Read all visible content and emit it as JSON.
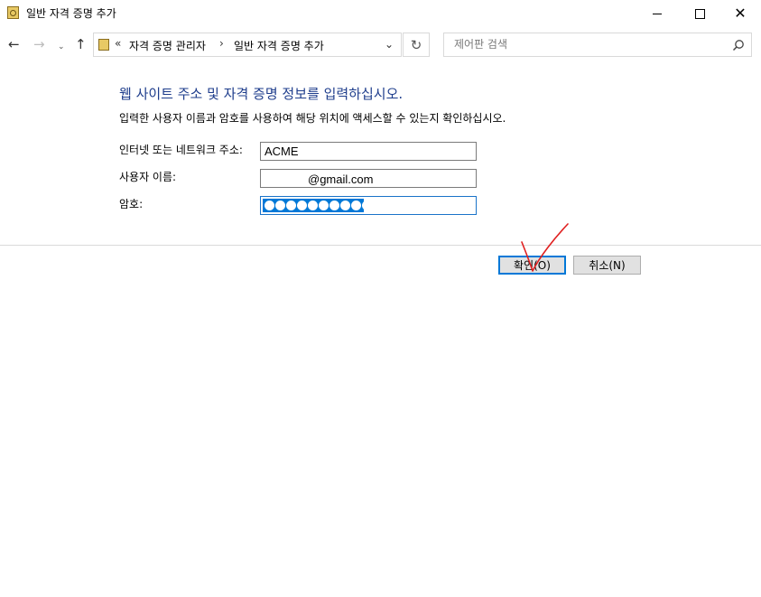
{
  "window": {
    "title": "일반 자격 증명 추가",
    "icon": "credential-manager-icon"
  },
  "nav": {
    "back_icon": "←",
    "forward_icon": "→",
    "recent_icon": "⌄",
    "up_icon": "↑",
    "breadcrumb_prefix": "«",
    "breadcrumb": [
      "자격 증명 관리자",
      "일반 자격 증명 추가"
    ],
    "breadcrumb_separator": "›",
    "dropdown_icon": "⌄",
    "refresh_icon": "↻",
    "search_placeholder": "제어판 검색"
  },
  "form": {
    "heading": "웹 사이트 주소 및 자격 증명 정보를 입력하십시오.",
    "instruction": "입력한 사용자 이름과 암호를 사용하여 해당 위치에 액세스할 수 있는지 확인하십시오.",
    "address_label": "인터넷 또는 네트워크 주소:",
    "address_value": "ACME",
    "username_label": "사용자 이름:",
    "username_value": "@gmail.com",
    "password_label": "암호:",
    "password_dot_count": 10
  },
  "buttons": {
    "ok_label": "확인(O)",
    "cancel_label": "취소(N)"
  },
  "colors": {
    "heading": "#1e3d8c",
    "accent": "#0078d7",
    "annotation": "#e02020"
  }
}
